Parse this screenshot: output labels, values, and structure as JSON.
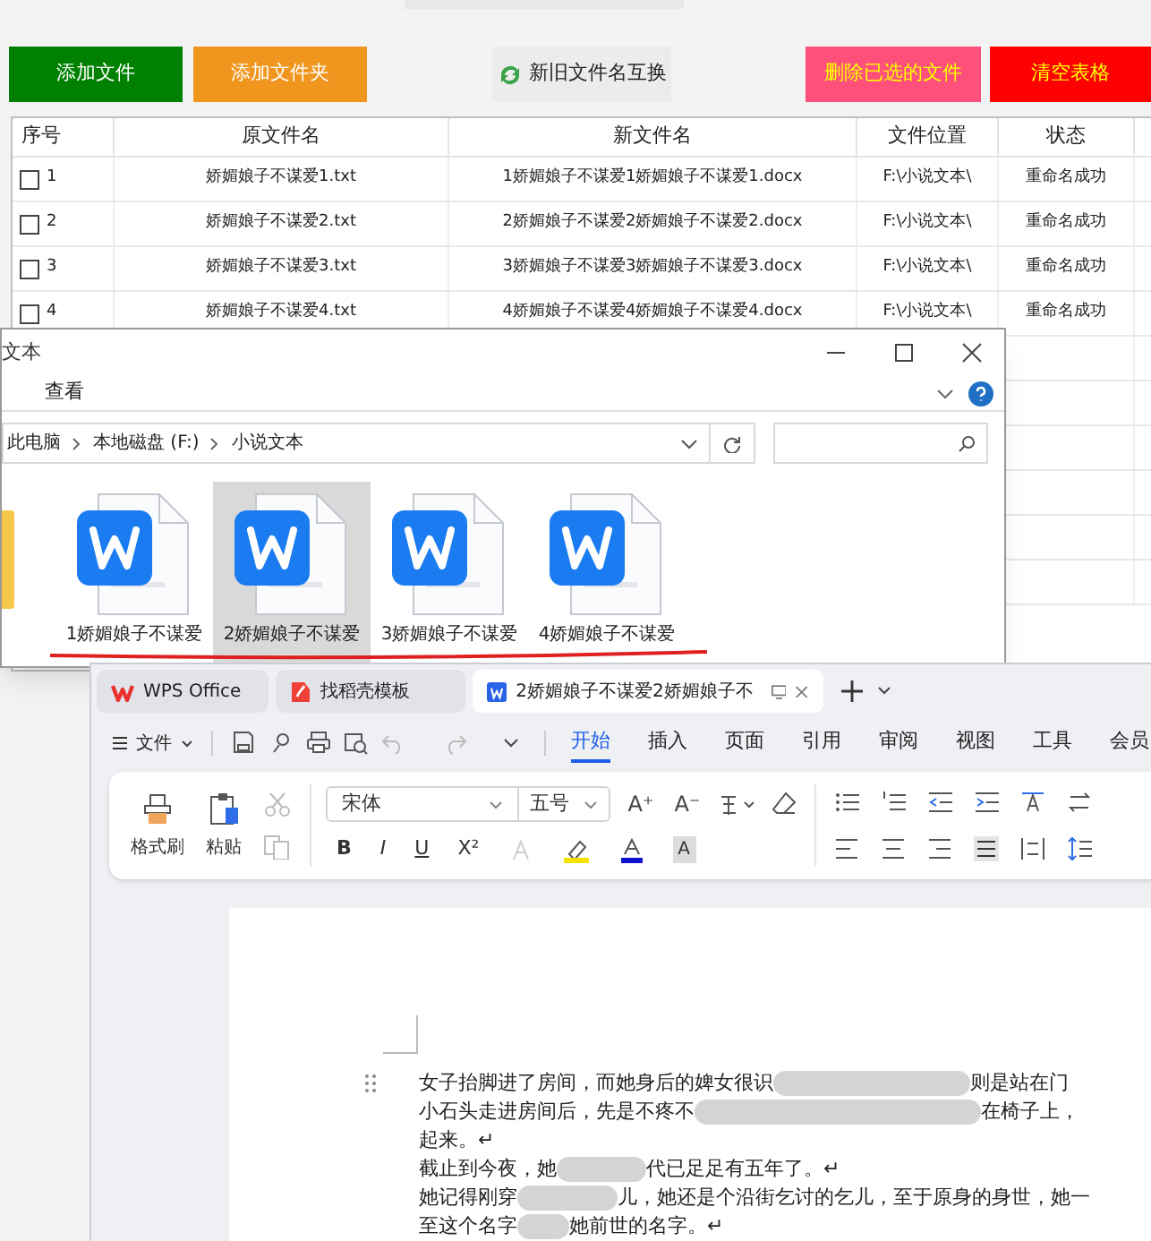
{
  "app": {
    "buttons": [
      {
        "label": "添加文件",
        "kind": "green"
      },
      {
        "label": "添加文件夹",
        "kind": "orange"
      },
      {
        "label": "新旧文件名互换",
        "kind": "swap"
      },
      {
        "label": "删除已选的文件",
        "kind": "pink"
      },
      {
        "label": "清空表格",
        "kind": "red"
      }
    ],
    "table": {
      "columns": [
        "序号",
        "原文件名",
        "新文件名",
        "文件位置",
        "状态"
      ],
      "rows": [
        {
          "checked": false,
          "cells": [
            "1",
            "娇媚娘子不谋爱1.txt",
            "1娇媚娘子不谋爱1娇媚娘子不谋爱1.docx",
            "F:\\小说文本\\",
            "重命名成功"
          ]
        },
        {
          "checked": false,
          "cells": [
            "2",
            "娇媚娘子不谋爱2.txt",
            "2娇媚娘子不谋爱2娇媚娘子不谋爱2.docx",
            "F:\\小说文本\\",
            "重命名成功"
          ]
        },
        {
          "checked": false,
          "cells": [
            "3",
            "娇媚娘子不谋爱3.txt",
            "3娇媚娘子不谋爱3娇媚娘子不谋爱3.docx",
            "F:\\小说文本\\",
            "重命名成功"
          ]
        },
        {
          "checked": false,
          "cells": [
            "4",
            "娇媚娘子不谋爱4.txt",
            "4娇媚娘子不谋爱4娇媚娘子不谋爱4.docx",
            "F:\\小说文本\\",
            "重命名成功"
          ]
        }
      ]
    }
  },
  "explorer": {
    "title": "文本",
    "ribbon_tab": "查看",
    "breadcrumb": [
      "此电脑",
      "本地磁盘 (F:)",
      "小说文本"
    ],
    "files": [
      {
        "name": "1娇媚娘子不谋爱",
        "selected": false
      },
      {
        "name": "2娇媚娘子不谋爱",
        "selected": true
      },
      {
        "name": "3娇媚娘子不谋爱",
        "selected": false
      },
      {
        "name": "4娇媚娘子不谋爱",
        "selected": false
      }
    ]
  },
  "wps": {
    "tabs": [
      {
        "label": "WPS Office",
        "kind": "home",
        "selected": false
      },
      {
        "label": "找稻壳模板",
        "kind": "templates",
        "selected": false
      },
      {
        "label": "2娇媚娘子不谋爱2娇媚娘子不",
        "kind": "document",
        "selected": true
      }
    ],
    "file_menu": "文件",
    "ribbon_tabs": [
      {
        "label": "开始",
        "selected": true
      },
      {
        "label": "插入",
        "selected": false
      },
      {
        "label": "页面",
        "selected": false
      },
      {
        "label": "引用",
        "selected": false
      },
      {
        "label": "审阅",
        "selected": false
      },
      {
        "label": "视图",
        "selected": false
      },
      {
        "label": "工具",
        "selected": false
      },
      {
        "label": "会员",
        "selected": false
      }
    ],
    "ribbon": {
      "format_painter": "格式刷",
      "paste": "粘贴",
      "font": "宋体",
      "size": "五号",
      "size_buttons": [
        "A⁺",
        "A⁻"
      ],
      "format_buttons": [
        "B",
        "I",
        "U",
        "X²"
      ],
      "shade_button": "A"
    },
    "document": {
      "lines": [
        {
          "segments": [
            "女子抬脚进了房间，而她身后的婢女很识",
            "则是站在门"
          ]
        },
        {
          "segments": [
            "小石头走进房间后，先是不疼不",
            "在椅子上，"
          ]
        },
        {
          "segments": [
            "起来。↵"
          ]
        },
        {
          "segments": [
            "截止到今夜，她",
            "代已足足有五年了。↵"
          ]
        },
        {
          "segments": [
            "她记得刚穿",
            "儿，她还是个沿街乞讨的乞儿，至于原身的身世，她一"
          ]
        },
        {
          "segments": [
            "至这个名字",
            "她前世的名字。↵"
          ]
        }
      ]
    }
  }
}
